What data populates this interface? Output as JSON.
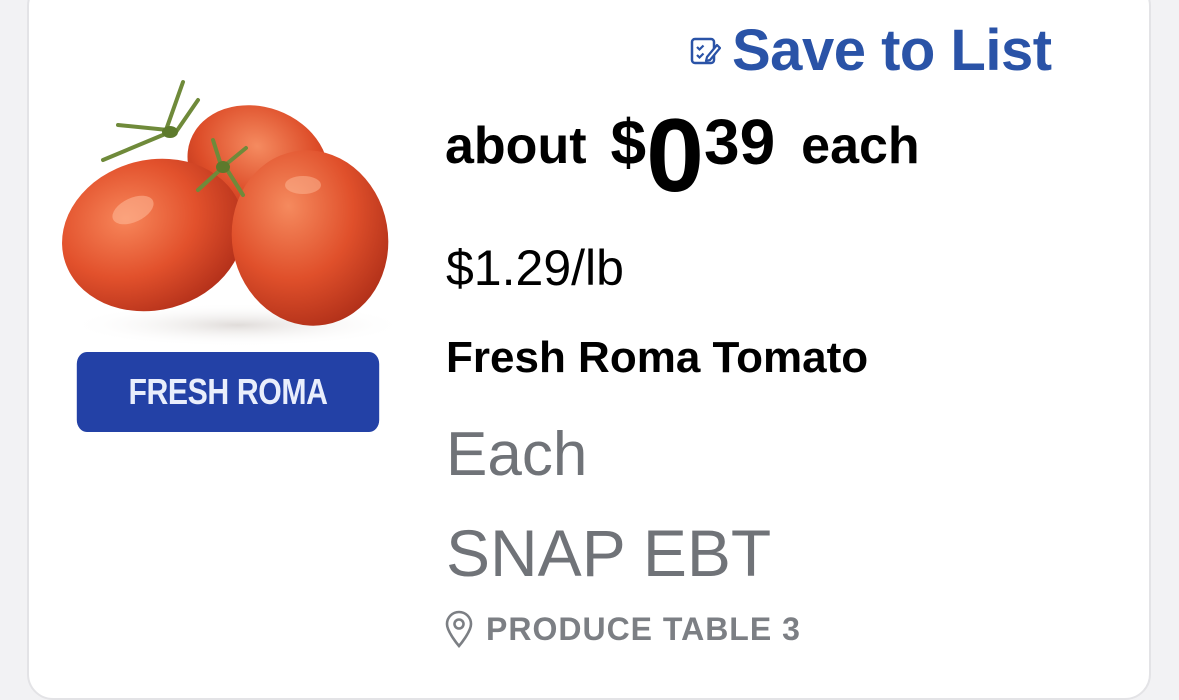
{
  "save": {
    "label": "Save to List",
    "icon": "edit-list-icon",
    "color": "#2a53a7"
  },
  "product": {
    "image_icon": "tomato-image",
    "badge": "FRESH ROMA",
    "badge_color": "#2341a6",
    "price_prefix": "about",
    "price_currency": "$",
    "price_dollars": "0",
    "price_cents": "39",
    "price_suffix": "each",
    "unit_price": "$1.29/lb",
    "name": "Fresh Roma Tomato",
    "unit": "Each",
    "payment": "SNAP EBT",
    "location_icon": "location-pin-icon",
    "location": "PRODUCE TABLE 3"
  }
}
